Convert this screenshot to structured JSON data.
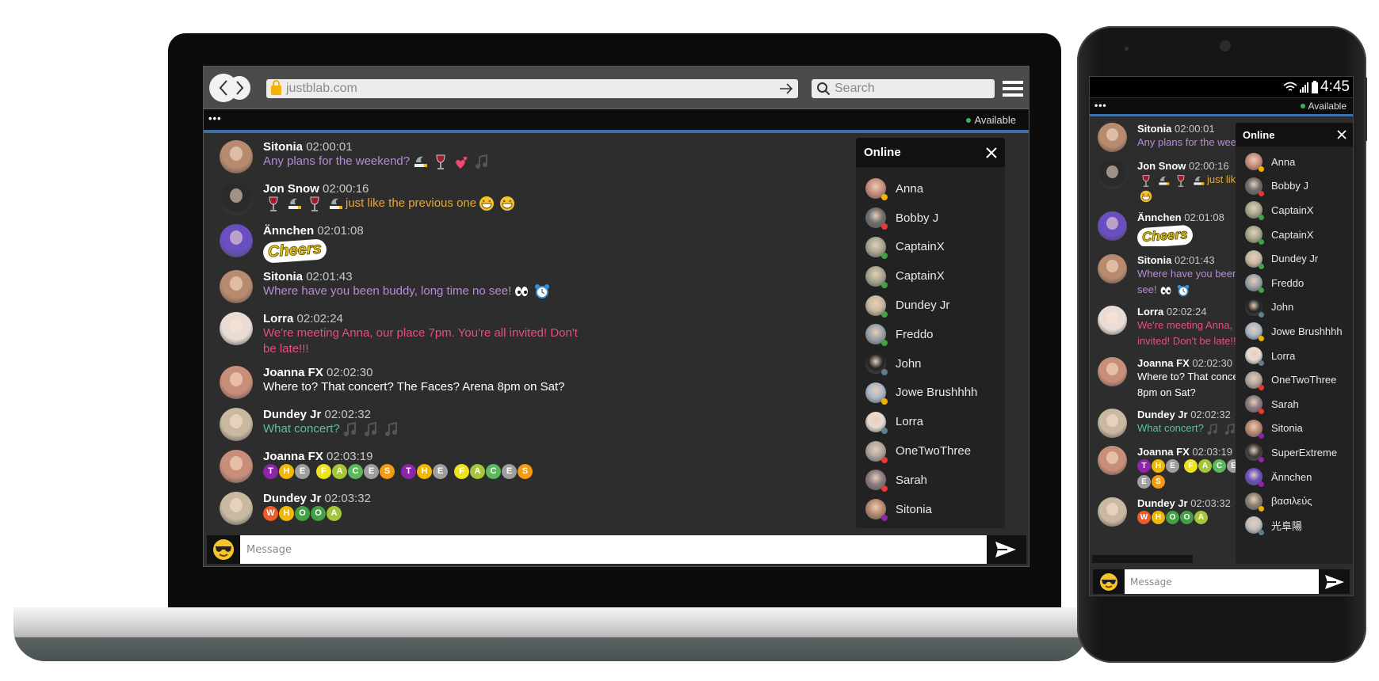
{
  "browser": {
    "url": "justblab.com",
    "search_placeholder": "Search"
  },
  "topbar": {
    "menu": "•••",
    "status": "Available"
  },
  "phone_status": {
    "time": "4:45"
  },
  "panel": {
    "title": "Online"
  },
  "input": {
    "placeholder": "Message"
  },
  "colors": {
    "accent_line": "#3b6fa8",
    "chat_bg": "#2d2d2d",
    "panel_bg": "#222222",
    "available": "#3fb34f"
  },
  "status_colors": {
    "away": "#f0b400",
    "busy": "#e53935",
    "online": "#43a047",
    "offline": "#607d8b",
    "invisible": "#8e24aa"
  },
  "letter_colors": {
    "T": "#8e24aa",
    "H": "#f2b705",
    "E": "#9e9e9e",
    "F": "#ede21b",
    "A": "#a4c639",
    "C": "#5cb85c",
    "S": "#f39c12",
    "W": "#f05a28",
    "O": "#43a047"
  },
  "avatars": {
    "Sitonia": "#b88a6e",
    "Jon Snow": "#2a2a2a",
    "Ännchen": "#6a4fc0",
    "Lorra": "#e8dcd4",
    "Joanna FX": "#c98e7a",
    "Dundey Jr": "#c8b9a0",
    "Anna": "#c98e7a",
    "Bobby J": "#6d6d6d",
    "CaptainX": "#a8a890",
    "Freddo": "#9aa3a8",
    "John": "#222222",
    "Jowe Brushhhh": "#aab8c8",
    "OneTwoThree": "#b0a6a0",
    "Sarah": "#8a7a80",
    "SuperExtreme": "#3a3a3a",
    "βασιλεύς": "#8a8070",
    "光阜陽": "#c0c0c0"
  },
  "sticker": {
    "text": "Cheers"
  },
  "messages": [
    {
      "user": "Sitonia",
      "time": "02:00:01",
      "color": "#b98ad8",
      "parts": [
        {
          "t": "Any plans for the weekend?"
        },
        {
          "i": "smoking-icon"
        },
        {
          "i": "wine-icon"
        },
        {
          "i": "hearts-icon"
        },
        {
          "i": "music-icon"
        }
      ]
    },
    {
      "user": "Jon Snow",
      "time": "02:00:16",
      "color": "#e6a833",
      "parts": [
        {
          "i": "wine-icon"
        },
        {
          "i": "smoking-icon"
        },
        {
          "i": "wine-icon"
        },
        {
          "i": "smoking-icon"
        },
        {
          "t": "just like the previous one"
        },
        {
          "i": "grin-icon"
        },
        {
          "i": "grin-icon"
        }
      ]
    },
    {
      "user": "Ännchen",
      "time": "02:01:08",
      "color": "#fff",
      "sticker": true,
      "parts": []
    },
    {
      "user": "Sitonia",
      "time": "02:01:43",
      "color": "#b98ad8",
      "parts": [
        {
          "t": "Where have you been buddy, long time no see!"
        },
        {
          "i": "eyes-icon"
        },
        {
          "i": "alarm-clock-icon"
        }
      ]
    },
    {
      "user": "Lorra",
      "time": "02:02:24",
      "color": "#e2507e",
      "parts": [
        {
          "t": "We're meeting Anna, our place 7pm. You're all invited! Don't be late!!!"
        }
      ]
    },
    {
      "user": "Joanna FX",
      "time": "02:02:30",
      "color": "#ffffff",
      "parts": [
        {
          "t": "Where to? That concert? The Faces? Arena 8pm on Sat?"
        }
      ]
    },
    {
      "user": "Dundey Jr",
      "time": "02:02:32",
      "color": "#5fbf9f",
      "parts": [
        {
          "t": "What concert?"
        },
        {
          "i": "music-icon"
        },
        {
          "i": "music-icon"
        },
        {
          "i": "music-icon"
        }
      ]
    },
    {
      "user": "Joanna FX",
      "time": "02:03:19",
      "color": "#fff",
      "letters": "THE FACES THE FACES",
      "parts": []
    },
    {
      "user": "Dundey Jr",
      "time": "02:03:32",
      "color": "#fff",
      "letters": "WHOOA",
      "parts": []
    }
  ],
  "online": [
    {
      "name": "Anna",
      "status": "away"
    },
    {
      "name": "Bobby J",
      "status": "busy"
    },
    {
      "name": "CaptainX",
      "status": "online"
    },
    {
      "name": "CaptainX",
      "status": "online"
    },
    {
      "name": "Dundey Jr",
      "status": "online"
    },
    {
      "name": "Freddo",
      "status": "online"
    },
    {
      "name": "John",
      "status": "offline"
    },
    {
      "name": "Jowe Brushhhh",
      "status": "away"
    },
    {
      "name": "Lorra",
      "status": "offline"
    },
    {
      "name": "OneTwoThree",
      "status": "busy"
    },
    {
      "name": "Sarah",
      "status": "busy"
    },
    {
      "name": "Sitonia",
      "status": "invisible"
    },
    {
      "name": "SuperExtreme",
      "status": "invisible"
    },
    {
      "name": "Ännchen",
      "status": "invisible"
    },
    {
      "name": "βασιλεύς",
      "status": "away"
    },
    {
      "name": "光阜陽",
      "status": "offline"
    }
  ]
}
